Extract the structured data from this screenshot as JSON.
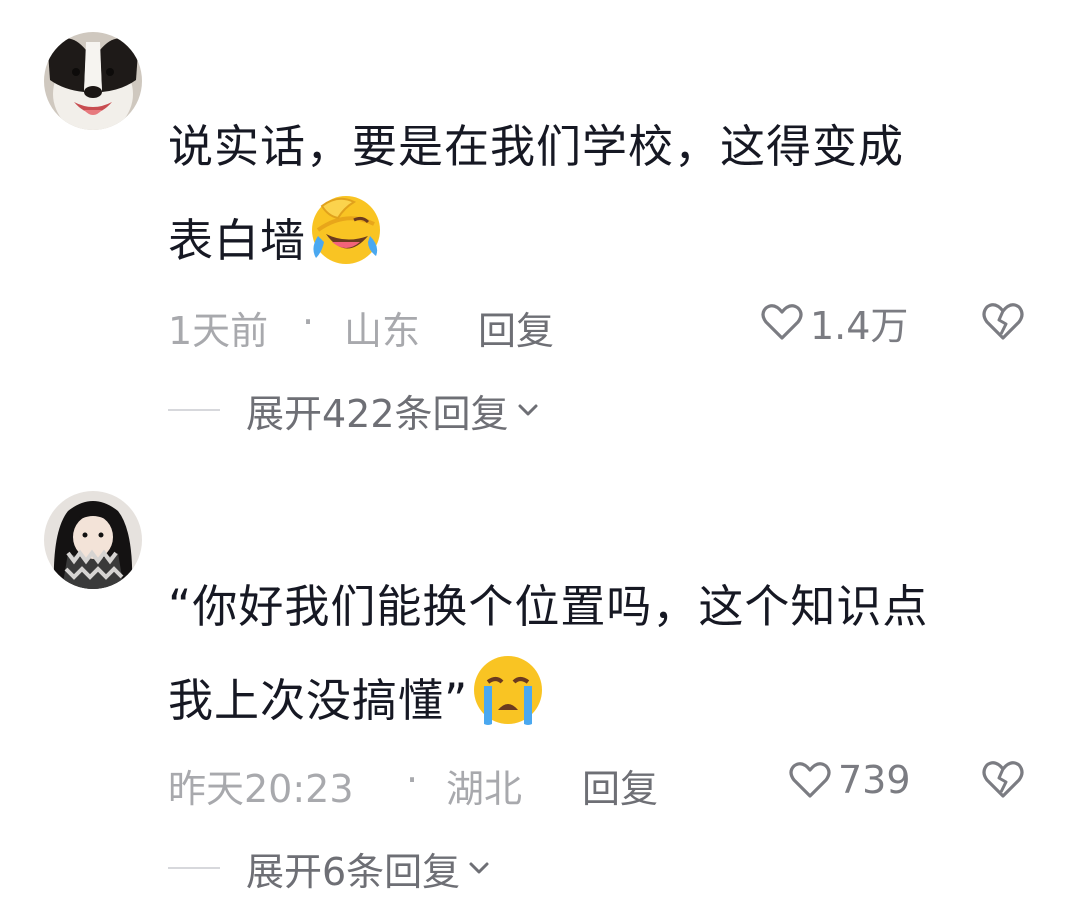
{
  "comments": [
    {
      "text_line1": "说实话，要是在我们学校，这得变成",
      "text_line2": "表白墙",
      "emoji": "laughing-crying-emoji",
      "time": "1天前",
      "dot": "·",
      "location": "山东",
      "reply_label": "回复",
      "likes": "1.4万",
      "expand_label": "展开422条回复",
      "avatar": "dog-avatar"
    },
    {
      "text_line1": "“你好我们能换个位置吗，这个知识点",
      "text_line2": "我上次没搞懂”",
      "emoji": "crying-emoji",
      "time": "昨天20:23",
      "dot": "·",
      "location": "湖北",
      "reply_label": "回复",
      "likes": "739",
      "expand_label": "展开6条回复",
      "avatar": "girl-scarf-avatar"
    }
  ],
  "icons": {
    "like": "heart-outline-icon",
    "dislike": "broken-heart-icon",
    "expand": "chevron-down-icon"
  },
  "colors": {
    "text": "#161823",
    "meta": "#a8a9ad",
    "action": "#6e6f75",
    "emoji_yellow": "#f9c423",
    "tear_blue": "#4aa8f0"
  }
}
